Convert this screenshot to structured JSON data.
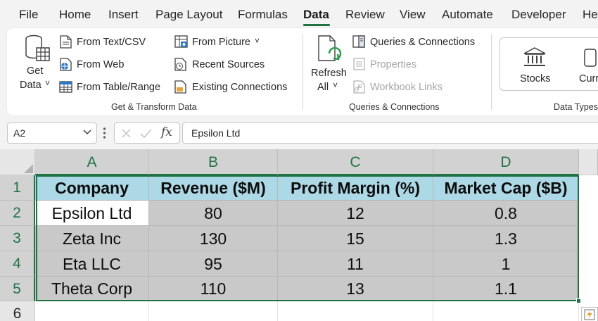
{
  "menu": {
    "tabs": [
      "File",
      "Home",
      "Insert",
      "Page Layout",
      "Formulas",
      "Data",
      "Review",
      "View",
      "Automate",
      "Developer",
      "He"
    ],
    "active": "Data"
  },
  "ribbon": {
    "get_data": {
      "line1": "Get",
      "line2": "Data",
      "chevron": "˅"
    },
    "get_transform": {
      "from_text_csv": "From Text/CSV",
      "from_web": "From Web",
      "from_table_range": "From Table/Range",
      "from_picture": "From Picture",
      "from_picture_chevron": "˅",
      "recent_sources": "Recent Sources",
      "existing_connections": "Existing Connections",
      "group_label": "Get & Transform Data"
    },
    "queries": {
      "refresh_line1": "Refresh",
      "refresh_line2": "All",
      "refresh_chevron": "˅",
      "queries_connections": "Queries & Connections",
      "properties": "Properties",
      "workbook_links": "Workbook Links",
      "group_label": "Queries & Connections"
    },
    "data_types": {
      "stocks": "Stocks",
      "currencies_partial": "Curr",
      "group_label": "Data Types"
    }
  },
  "formula_bar": {
    "name_box": "A2",
    "formula": "Epsilon Ltd",
    "fx": "fx"
  },
  "sheet": {
    "columns": [
      "A",
      "B",
      "C",
      "D"
    ],
    "rows": [
      "1",
      "2",
      "3",
      "4",
      "5",
      "6"
    ],
    "header": [
      "Company",
      "Revenue ($M)",
      "Profit Margin (%)",
      "Market Cap ($B)"
    ],
    "data": [
      [
        "Epsilon Ltd",
        "80",
        "12",
        "0.8"
      ],
      [
        "Zeta Inc",
        "130",
        "15",
        "1.3"
      ],
      [
        "Eta LLC",
        "95",
        "11",
        "1"
      ],
      [
        "Theta Corp",
        "110",
        "13",
        "1.1"
      ]
    ],
    "colors": {
      "header_fill": "#add8e6",
      "data_fill": "#c9c9c9",
      "accent": "#217346"
    }
  }
}
